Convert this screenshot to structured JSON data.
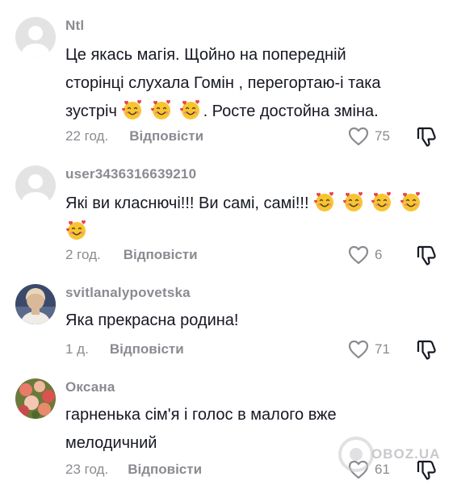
{
  "comments": [
    {
      "username": "Ntl",
      "avatar": "default-avatar",
      "text_lines": [
        "Це якась магія. Щойно на попередній",
        "сторінці слухала Гомін , перегортаю-і така"
      ],
      "text_line3_start": "зустріч",
      "text_line3_end": ". Росте достойна зміна.",
      "emoji": "smiling-face-with-hearts",
      "emoji_count": 3,
      "time": "22 год.",
      "reply_label": "Відповісти",
      "likes": "75"
    },
    {
      "username": "user3436316639210",
      "avatar": "default-avatar",
      "text_line1": "Які ви класнючі!!! Ви самі, самі!!!",
      "emoji": "smiling-face-with-hearts",
      "emoji_count": 5,
      "time": "2 год.",
      "reply_label": "Відповісти",
      "likes": "6"
    },
    {
      "username": "svitlanalypovetska",
      "avatar": "photo-avatar-woman",
      "text": "Яка прекрасна родина!",
      "time": "1 д.",
      "reply_label": "Відповісти",
      "likes": "71"
    },
    {
      "username": "Оксана",
      "avatar": "photo-avatar-flowers",
      "text_lines": [
        "гарненька сім'я і голос в малого вже",
        "мелодичний"
      ],
      "time": "23 год.",
      "reply_label": "Відповісти",
      "likes": "61"
    }
  ],
  "watermark": "OBOZ.UA",
  "colors": {
    "text": "#161823",
    "secondary": "#8a8b91",
    "avatar_default": "#e3e3e4"
  }
}
